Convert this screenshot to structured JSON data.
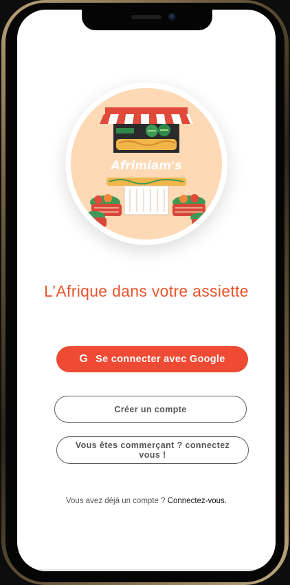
{
  "app": {
    "logo_text": "Afrimiam's",
    "tagline": "L’Afrique dans votre assiette"
  },
  "actions": {
    "google_icon": "G",
    "google_label": "Se connecter avec Google",
    "create_account_label": "Créer un compte",
    "merchant_label": "Vous êtes commerçant ? connectez vous !"
  },
  "footer": {
    "prompt": "Vous avez déjà un compte ?",
    "link": "Connectez-vous."
  },
  "colors": {
    "accent": "#ee4a34",
    "tagline": "#e8542c",
    "logo_bg": "#fdd9b5"
  },
  "icons": {
    "google": "google-icon",
    "logo": "market-stall-logo"
  }
}
